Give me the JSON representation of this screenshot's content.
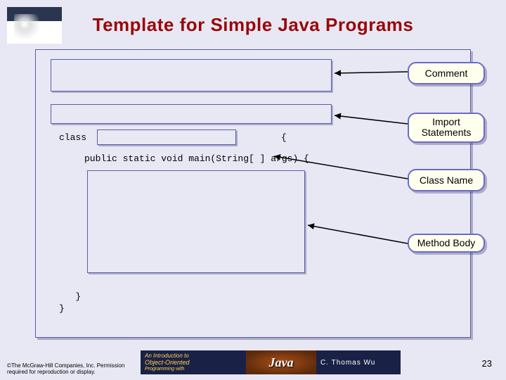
{
  "title": "Template for Simple Java Programs",
  "labels": {
    "comment": "Comment",
    "import": "Import\nStatements",
    "className": "Class Name",
    "methodBody": "Method Body"
  },
  "code": {
    "classKeyword": "class",
    "classOpenBrace": "{",
    "mainSignature": "public static void main(String[ ] args) {",
    "closingBraces": "   }\n}"
  },
  "footer": {
    "copyright": "©The McGraw-Hill Companies, Inc. Permission required for reproduction or display."
  },
  "banner": {
    "line1": "An Introduction to",
    "line2": "Object-Oriented",
    "line3": "Programming with",
    "logo": "Java",
    "author": "C. Thomas Wu"
  },
  "pageNumber": "23"
}
